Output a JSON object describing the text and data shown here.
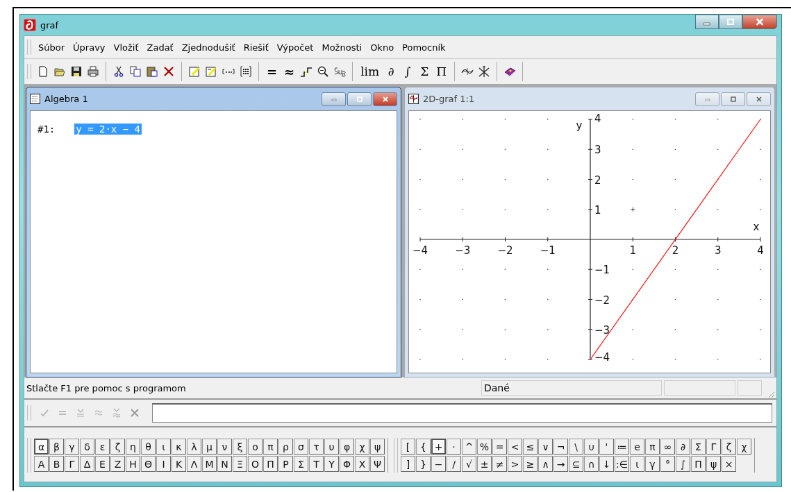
{
  "window": {
    "title": "graf"
  },
  "menu": [
    "Súbor",
    "Úpravy",
    "Vložiť",
    "Zadať",
    "Zjednodušiť",
    "Riešiť",
    "Výpočet",
    "Možnosti",
    "Okno",
    "Pomocník"
  ],
  "toolbar": {
    "relation_symbols": [
      "=",
      "≈"
    ],
    "calculus_symbols": [
      "lim",
      "∂",
      "∫",
      "Σ",
      "Π"
    ]
  },
  "algebra_window": {
    "title": "Algebra 1",
    "expressions": [
      {
        "label": "#1:",
        "expression": "y = 2·x − 4",
        "selected": true
      }
    ]
  },
  "graph_window": {
    "title": "2D-graf 1:1",
    "chart_data": {
      "type": "line",
      "xlabel": "x",
      "ylabel": "y",
      "xlim": [
        -4,
        4
      ],
      "ylim": [
        -4,
        4
      ],
      "xticks": [
        {
          "value": -4,
          "label": "−4"
        },
        {
          "value": -3,
          "label": "−3"
        },
        {
          "value": -2,
          "label": "−2"
        },
        {
          "value": -1,
          "label": "−1"
        },
        {
          "value": 1,
          "label": "1"
        },
        {
          "value": 2,
          "label": "2"
        },
        {
          "value": 3,
          "label": "3"
        },
        {
          "value": 4,
          "label": "4"
        }
      ],
      "yticks": [
        {
          "value": 4,
          "label": "4"
        },
        {
          "value": 3,
          "label": "3"
        },
        {
          "value": 2,
          "label": "2"
        },
        {
          "value": 1,
          "label": "1"
        },
        {
          "value": -1,
          "label": "−1"
        },
        {
          "value": -2,
          "label": "−2"
        },
        {
          "value": -3,
          "label": "−3"
        },
        {
          "value": -4,
          "label": "−4"
        }
      ],
      "x": [
        0,
        4
      ],
      "series": [
        {
          "color": "#ff0000",
          "values": [
            -4,
            4
          ]
        }
      ]
    }
  },
  "status_bar": {
    "message": "Stlačte F1 pre pomoc s programom",
    "state": "Dané"
  },
  "greek_palette": [
    [
      {
        "label": "α",
        "selected": true
      },
      {
        "label": "β",
        "selected": false
      },
      {
        "label": "γ",
        "selected": false
      },
      {
        "label": "δ",
        "selected": false
      },
      {
        "label": "ε",
        "selected": false
      },
      {
        "label": "ζ",
        "selected": false
      },
      {
        "label": "η",
        "selected": false
      },
      {
        "label": "θ",
        "selected": false
      },
      {
        "label": "ι",
        "selected": false
      },
      {
        "label": "κ",
        "selected": false
      },
      {
        "label": "λ",
        "selected": false
      },
      {
        "label": "μ",
        "selected": false
      },
      {
        "label": "ν",
        "selected": false
      },
      {
        "label": "ξ",
        "selected": false
      },
      {
        "label": "ο",
        "selected": false
      },
      {
        "label": "π",
        "selected": false
      },
      {
        "label": "ρ",
        "selected": false
      },
      {
        "label": "σ",
        "selected": false
      },
      {
        "label": "τ",
        "selected": false
      },
      {
        "label": "υ",
        "selected": false
      },
      {
        "label": "φ",
        "selected": false
      },
      {
        "label": "χ",
        "selected": false
      },
      {
        "label": "ψ",
        "selected": false
      }
    ],
    [
      {
        "label": "Α",
        "selected": false
      },
      {
        "label": "Β",
        "selected": false
      },
      {
        "label": "Γ",
        "selected": false
      },
      {
        "label": "Δ",
        "selected": false
      },
      {
        "label": "Ε",
        "selected": false
      },
      {
        "label": "Ζ",
        "selected": false
      },
      {
        "label": "Η",
        "selected": false
      },
      {
        "label": "Θ",
        "selected": false
      },
      {
        "label": "Ι",
        "selected": false
      },
      {
        "label": "Κ",
        "selected": false
      },
      {
        "label": "Λ",
        "selected": false
      },
      {
        "label": "Μ",
        "selected": false
      },
      {
        "label": "Ν",
        "selected": false
      },
      {
        "label": "Ξ",
        "selected": false
      },
      {
        "label": "Ο",
        "selected": false
      },
      {
        "label": "Π",
        "selected": false
      },
      {
        "label": "Ρ",
        "selected": false
      },
      {
        "label": "Σ",
        "selected": false
      },
      {
        "label": "Τ",
        "selected": false
      },
      {
        "label": "Υ",
        "selected": false
      },
      {
        "label": "Φ",
        "selected": false
      },
      {
        "label": "Χ",
        "selected": false
      },
      {
        "label": "Ψ",
        "selected": false
      }
    ]
  ],
  "symbol_palette": [
    [
      {
        "label": "[",
        "selected": false
      },
      {
        "label": "{",
        "selected": false
      },
      {
        "label": "+",
        "selected": true
      },
      {
        "label": "·",
        "selected": false
      },
      {
        "label": "^",
        "selected": false
      },
      {
        "label": "%",
        "selected": false
      },
      {
        "label": "=",
        "selected": false
      },
      {
        "label": "<",
        "selected": false
      },
      {
        "label": "≤",
        "selected": false
      },
      {
        "label": "∨",
        "selected": false
      },
      {
        "label": "¬",
        "selected": false
      },
      {
        "label": "\\",
        "selected": false
      },
      {
        "label": "∪",
        "selected": false
      },
      {
        "label": "'",
        "selected": false
      },
      {
        "label": "≔",
        "selected": false
      },
      {
        "label": "e",
        "selected": false
      },
      {
        "label": "π",
        "selected": false
      },
      {
        "label": "∞",
        "selected": false
      },
      {
        "label": "∂",
        "selected": false
      },
      {
        "label": "Σ",
        "selected": false
      },
      {
        "label": "Γ",
        "selected": false
      },
      {
        "label": "ζ",
        "selected": false
      },
      {
        "label": "χ",
        "selected": false
      }
    ],
    [
      {
        "label": "]",
        "selected": false
      },
      {
        "label": "}",
        "selected": false
      },
      {
        "label": "−",
        "selected": false
      },
      {
        "label": "/",
        "selected": false
      },
      {
        "label": "√",
        "selected": false
      },
      {
        "label": "±",
        "selected": false
      },
      {
        "label": "≠",
        "selected": false
      },
      {
        "label": ">",
        "selected": false
      },
      {
        "label": "≥",
        "selected": false
      },
      {
        "label": "∧",
        "selected": false
      },
      {
        "label": "→",
        "selected": false
      },
      {
        "label": "⊆",
        "selected": false
      },
      {
        "label": "∩",
        "selected": false
      },
      {
        "label": "↓",
        "selected": false
      },
      {
        "label": ":∈",
        "selected": false
      },
      {
        "label": "ι",
        "selected": false
      },
      {
        "label": "γ",
        "selected": false
      },
      {
        "label": "°",
        "selected": false
      },
      {
        "label": "∫",
        "selected": false
      },
      {
        "label": "Π",
        "selected": false
      },
      {
        "label": "ψ",
        "selected": false
      },
      {
        "label": "×",
        "selected": false
      }
    ]
  ]
}
